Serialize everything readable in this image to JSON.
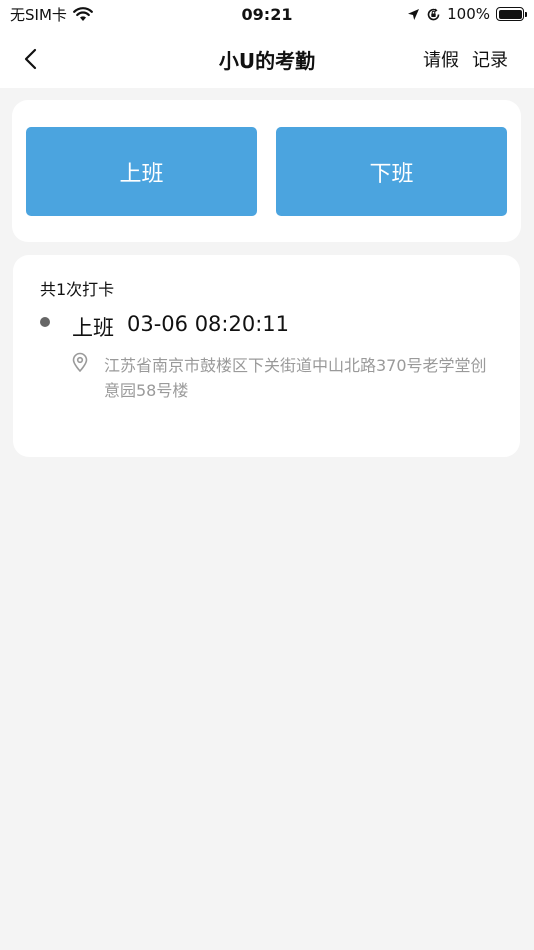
{
  "status_bar": {
    "carrier": "无SIM卡",
    "time": "09:21",
    "battery": "100%"
  },
  "nav": {
    "title": "小U的考勤",
    "leave_label": "请假",
    "records_label": "记录"
  },
  "actions": {
    "clock_in_label": "上班",
    "clock_out_label": "下班"
  },
  "summary": {
    "count_text": "共1次打卡"
  },
  "records": [
    {
      "type": "上班",
      "time": "03-06 08:20:11",
      "address": "江苏省南京市鼓楼区下关街道中山北路370号老学堂创意园58号楼"
    }
  ],
  "icons": {
    "back": "chevron-left-icon",
    "wifi": "wifi-icon",
    "location_arrow": "location-arrow-icon",
    "rotation_lock": "rotation-lock-icon",
    "battery": "battery-icon",
    "pin": "location-pin-icon"
  },
  "colors": {
    "primary_button": "#4ba4df",
    "page_background": "#f4f4f4",
    "address_text": "#9a9a9a"
  }
}
